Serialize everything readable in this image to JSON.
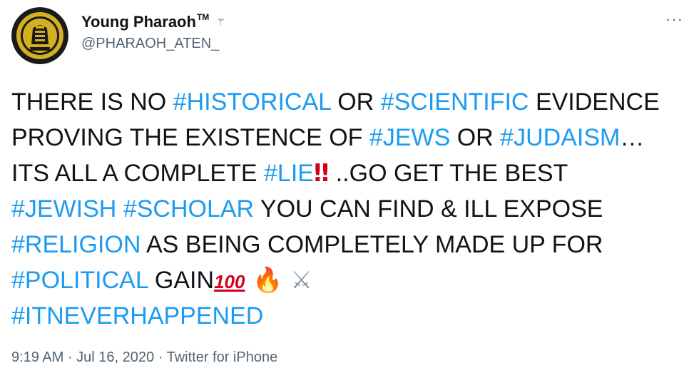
{
  "user": {
    "display_name": "Young Pharaoh",
    "tm": "TM",
    "badge_emoji": "⚚",
    "handle": "@PHARAOH_ATEN_"
  },
  "menu": {
    "more_label": "···"
  },
  "tweet": {
    "lines": [
      [
        {
          "text": "THERE IS NO ",
          "type": "text"
        },
        {
          "text": "#HISTORICAL",
          "type": "hashtag"
        },
        {
          "text": " OR ",
          "type": "text"
        },
        {
          "text": "#SCIENTIFIC",
          "type": "hashtag"
        },
        {
          "text": " EVIDENCE",
          "type": "text"
        }
      ],
      [
        {
          "text": "PROVING THE EXISTENCE OF ",
          "type": "text"
        },
        {
          "text": "#JEWS",
          "type": "hashtag"
        },
        {
          "text": " OR ",
          "type": "text"
        },
        {
          "text": "#JUDAISM",
          "type": "hashtag"
        },
        {
          "text": "…",
          "type": "text"
        }
      ],
      [
        {
          "text": "ITS ALL A COMPLETE ",
          "type": "text"
        },
        {
          "text": "#LIE",
          "type": "hashtag"
        },
        {
          "text": "‼",
          "type": "bang"
        },
        {
          "text": " ..GO GET THE BEST",
          "type": "text"
        }
      ],
      [
        {
          "text": "#JEWISH",
          "type": "hashtag"
        },
        {
          "text": " ",
          "type": "text"
        },
        {
          "text": "#SCHOLAR",
          "type": "hashtag"
        },
        {
          "text": " YOU CAN FIND & ILL EXPOSE",
          "type": "text"
        }
      ],
      [
        {
          "text": "#RELIGION",
          "type": "hashtag"
        },
        {
          "text": " AS BEING COMPLETELY MADE UP FOR",
          "type": "text"
        }
      ],
      [
        {
          "text": "#POLITICAL",
          "type": "hashtag"
        },
        {
          "text": " GAIN",
          "type": "text"
        },
        {
          "text": "100",
          "type": "hundred"
        },
        {
          "text": " 🔥",
          "type": "fire"
        },
        {
          "text": " ⚔",
          "type": "swords"
        }
      ],
      [
        {
          "text": "#ITNEVERHAPPENED",
          "type": "hashtag"
        }
      ]
    ]
  },
  "meta": {
    "time": "9:19 AM",
    "sep1": " · ",
    "date": "Jul 16, 2020",
    "sep2": " · ",
    "source": "Twitter for iPhone"
  },
  "colors": {
    "hashtag": "#1d9bf0",
    "text": "#0f1419",
    "muted": "#536471",
    "avatar_bg": "#1a1a1a",
    "avatar_gold": "#d4b020"
  }
}
